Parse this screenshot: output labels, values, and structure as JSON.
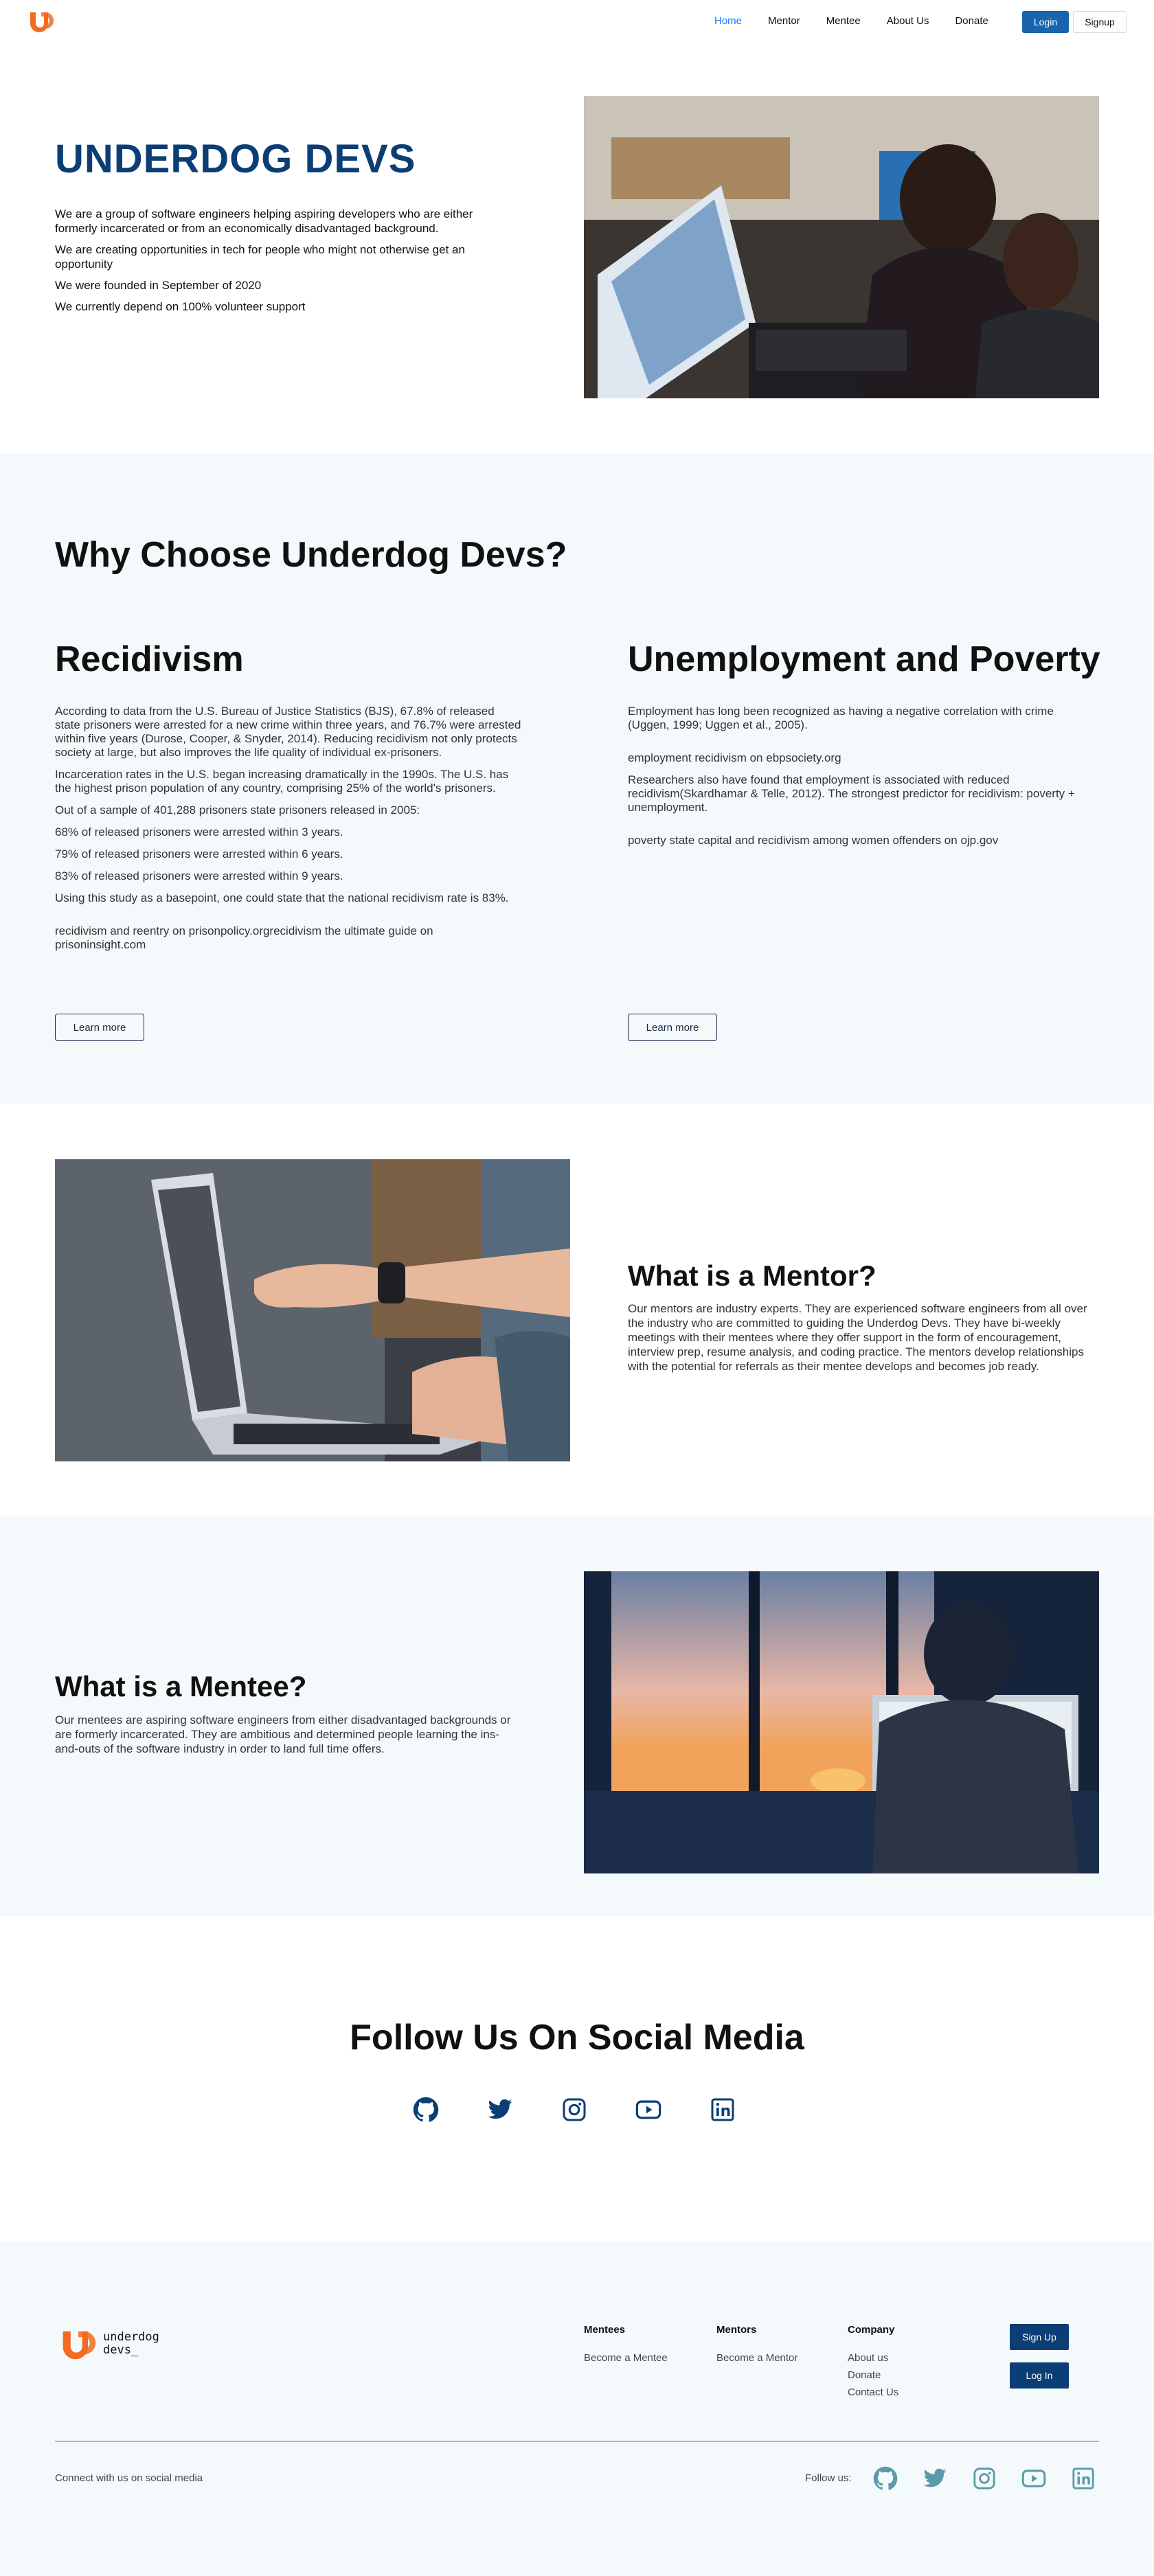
{
  "nav": {
    "links": [
      {
        "label": "Home",
        "active": true
      },
      {
        "label": "Mentor"
      },
      {
        "label": "Mentee"
      },
      {
        "label": "About Us"
      },
      {
        "label": "Donate"
      }
    ],
    "login_label": "Login",
    "signup_label": "Signup"
  },
  "hero": {
    "title": "UNDERDOG DEVS",
    "paragraphs": [
      "We are a group of software engineers helping aspiring developers who are either formerly incarcerated or from an economically disadvantaged background.",
      "We are creating opportunities in tech for people who might not otherwise get an opportunity",
      "We were founded in September of 2020",
      "We currently depend on 100% volunteer support"
    ]
  },
  "why": {
    "title": "Why Choose Underdog Devs?",
    "recidivism": {
      "title": "Recidivism",
      "paragraphs": [
        "According to data from the U.S. Bureau of Justice Statistics (BJS), 67.8% of released state prisoners were arrested for a new crime within three years, and 76.7% were arrested within five years (Durose, Cooper, & Snyder, 2014). Reducing recidivism not only protects society at large, but also improves the life quality of individual ex-prisoners.",
        "Incarceration rates in the U.S. began increasing dramatically in the 1990s. The U.S. has the highest prison population of any country, comprising 25% of the world's prisoners.",
        "Out of a sample of 401,288 prisoners state prisoners released in 2005:",
        "68% of released prisoners were arrested within 3 years.",
        "79% of released prisoners were arrested within 6 years.",
        "83% of released prisoners were arrested within 9 years.",
        "Using this study as a basepoint, one could state that the national recidivism rate is 83%."
      ],
      "links": "recidivism and reentry on prisonpolicy.orgrecidivism the ultimate guide on prisoninsight.com",
      "button": "Learn more"
    },
    "unemployment": {
      "title": "Unemployment and Poverty",
      "p1": "Employment has long been recognized as having a negative correlation with crime (Uggen, 1999; Uggen et al., 2005).",
      "p2": "employment recidivism on ebpsociety.org",
      "p3": "Researchers also have found that employment is associated with reduced recidivism(Skardhamar & Telle, 2012). The strongest predictor for recidivism: poverty + unemployment.",
      "p4": "poverty state capital and recidivism among women offenders on ojp.gov",
      "button": "Learn more"
    }
  },
  "mentor": {
    "title": "What is a Mentor?",
    "text": "Our mentors are industry experts. They are experienced software engineers from all over the industry who are committed to guiding the Underdog Devs. They have bi-weekly meetings with their mentees where they offer support in the form of encouragement, interview prep, resume analysis, and coding practice. The mentors develop relationships with the potential for referrals as their mentee develops and becomes job ready."
  },
  "mentee": {
    "title": "What is a Mentee?",
    "text": "Our mentees are aspiring software engineers from either disadvantaged backgrounds or are formerly incarcerated. They are ambitious and determined people learning the ins-and-outs of the software industry in order to land full time offers."
  },
  "social": {
    "title": "Follow Us On Social Media",
    "icons": [
      "github-icon",
      "twitter-icon",
      "instagram-icon",
      "youtube-icon",
      "linkedin-icon"
    ]
  },
  "footer": {
    "logo_line1": "underdog",
    "logo_line2": "devs_",
    "mentees": {
      "title": "Mentees",
      "items": [
        "Become a Mentee"
      ]
    },
    "mentors": {
      "title": "Mentors",
      "items": [
        "Become a Mentor"
      ]
    },
    "company": {
      "title": "Company",
      "items": [
        "About us",
        "Donate",
        "Contact Us"
      ]
    },
    "signup_label": "Sign Up",
    "login_label": "Log In",
    "connect_text": "Connect with us on social media",
    "follow_text": "Follow us:"
  },
  "colors": {
    "brand_orange": "#f26b21",
    "brand_navy": "#0b3e74",
    "nav_active": "#1677ff",
    "login_blue": "#1765ad",
    "section_bg": "#f4fafb",
    "footer_icon": "#5b9aa9"
  }
}
